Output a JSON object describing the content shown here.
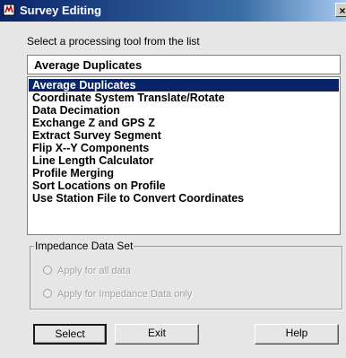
{
  "window": {
    "title": "Survey Editing",
    "close_glyph": "×",
    "icon": "app-icon"
  },
  "instruction": "Select a processing tool from the list",
  "selected_tool": "Average Duplicates",
  "tools": [
    "Average Duplicates",
    "Coordinate System Translate/Rotate",
    "Data Decimation",
    "Exchange Z and GPS Z",
    "Extract Survey Segment",
    "Flip X--Y Components",
    "Line Length Calculator",
    "Profile Merging",
    "Sort Locations on Profile",
    "Use Station File to Convert Coordinates"
  ],
  "impedance": {
    "legend": "Impedance Data Set",
    "options": [
      "Apply for all data",
      "Apply for Impedance Data only"
    ],
    "enabled": false
  },
  "buttons": {
    "select": "Select",
    "exit": "Exit",
    "help": "Help"
  },
  "colors": {
    "selection": "#0a246a",
    "title_gradient_start": "#0a246a",
    "title_gradient_end": "#a6caf0",
    "disabled_text": "#a0a0a0"
  }
}
